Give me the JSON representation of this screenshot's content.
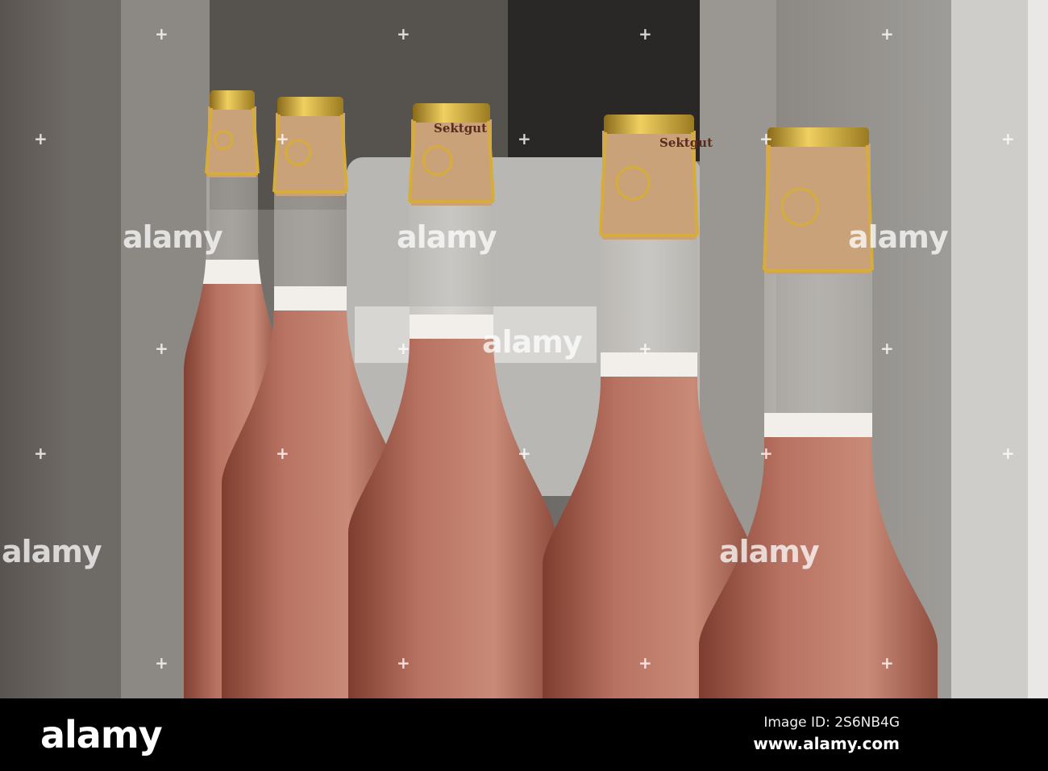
{
  "photo": {
    "subject": "bottles",
    "cork_print": "Sektgut",
    "colors": {
      "steel": "#8a8784",
      "liquid": "#b0665a",
      "foil": "#d6ad3a",
      "cork": "#c9a27a"
    }
  },
  "watermark": {
    "text": "alamy",
    "plus_glyph": "+"
  },
  "footer": {
    "logo": "alamy",
    "image_id": "Image ID: 2S6NB4G",
    "website": "www.alamy.com"
  }
}
